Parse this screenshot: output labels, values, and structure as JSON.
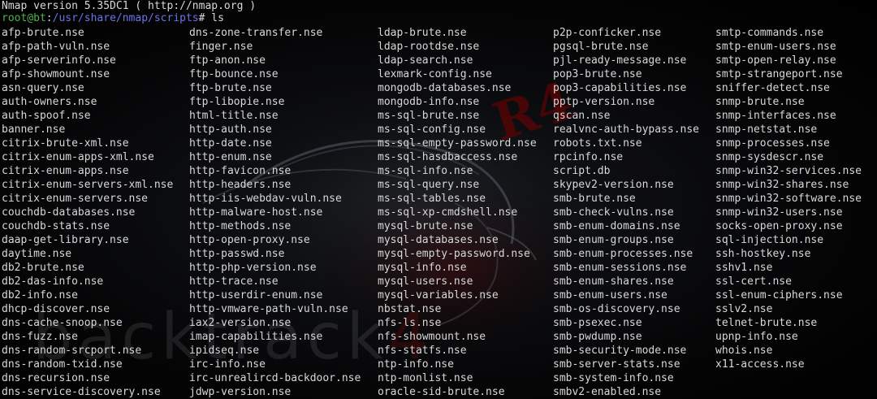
{
  "header": {
    "version_line": "Nmap version 5.35DC1 ( http://nmap.org )"
  },
  "prompt": {
    "user_host": "root@bt",
    "colon": ":",
    "path": "/usr/share/nmap/scripts",
    "symbol": "#",
    "command": " ls"
  },
  "wallpaper": {
    "watermark_left": "back",
    "watermark_mid": "track",
    "watermark_num": "4",
    "corner_mark": "R4",
    "accent_color": "#7a0000"
  },
  "colors": {
    "text": "#d8d8d8",
    "prompt_user": "#4fb34f",
    "prompt_path": "#6b74e8",
    "background": "#000000"
  },
  "listing": [
    [
      "afp-brute.nse",
      "afp-path-vuln.nse",
      "afp-serverinfo.nse",
      "afp-showmount.nse",
      "asn-query.nse",
      "auth-owners.nse",
      "auth-spoof.nse",
      "banner.nse",
      "citrix-brute-xml.nse",
      "citrix-enum-apps-xml.nse",
      "citrix-enum-apps.nse",
      "citrix-enum-servers-xml.nse",
      "citrix-enum-servers.nse",
      "couchdb-databases.nse",
      "couchdb-stats.nse",
      "daap-get-library.nse",
      "daytime.nse",
      "db2-brute.nse",
      "db2-das-info.nse",
      "db2-info.nse",
      "dhcp-discover.nse",
      "dns-cache-snoop.nse",
      "dns-fuzz.nse",
      "dns-random-srcport.nse",
      "dns-random-txid.nse",
      "dns-recursion.nse",
      "dns-service-discovery.nse"
    ],
    [
      "dns-zone-transfer.nse",
      "finger.nse",
      "ftp-anon.nse",
      "ftp-bounce.nse",
      "ftp-brute.nse",
      "ftp-libopie.nse",
      "html-title.nse",
      "http-auth.nse",
      "http-date.nse",
      "http-enum.nse",
      "http-favicon.nse",
      "http-headers.nse",
      "http-iis-webdav-vuln.nse",
      "http-malware-host.nse",
      "http-methods.nse",
      "http-open-proxy.nse",
      "http-passwd.nse",
      "http-php-version.nse",
      "http-trace.nse",
      "http-userdir-enum.nse",
      "http-vmware-path-vuln.nse",
      "iax2-version.nse",
      "imap-capabilities.nse",
      "ipidseq.nse",
      "irc-info.nse",
      "irc-unrealircd-backdoor.nse",
      "jdwp-version.nse"
    ],
    [
      "ldap-brute.nse",
      "ldap-rootdse.nse",
      "ldap-search.nse",
      "lexmark-config.nse",
      "mongodb-databases.nse",
      "mongodb-info.nse",
      "ms-sql-brute.nse",
      "ms-sql-config.nse",
      "ms-sql-empty-password.nse",
      "ms-sql-hasdbaccess.nse",
      "ms-sql-info.nse",
      "ms-sql-query.nse",
      "ms-sql-tables.nse",
      "ms-sql-xp-cmdshell.nse",
      "mysql-brute.nse",
      "mysql-databases.nse",
      "mysql-empty-password.nse",
      "mysql-info.nse",
      "mysql-users.nse",
      "mysql-variables.nse",
      "nbstat.nse",
      "nfs-ls.nse",
      "nfs-showmount.nse",
      "nfs-statfs.nse",
      "ntp-info.nse",
      "ntp-monlist.nse",
      "oracle-sid-brute.nse"
    ],
    [
      "p2p-conficker.nse",
      "pgsql-brute.nse",
      "pjl-ready-message.nse",
      "pop3-brute.nse",
      "pop3-capabilities.nse",
      "pptp-version.nse",
      "qscan.nse",
      "realvnc-auth-bypass.nse",
      "robots.txt.nse",
      "rpcinfo.nse",
      "script.db",
      "skypev2-version.nse",
      "smb-brute.nse",
      "smb-check-vulns.nse",
      "smb-enum-domains.nse",
      "smb-enum-groups.nse",
      "smb-enum-processes.nse",
      "smb-enum-sessions.nse",
      "smb-enum-shares.nse",
      "smb-enum-users.nse",
      "smb-os-discovery.nse",
      "smb-psexec.nse",
      "smb-pwdump.nse",
      "smb-security-mode.nse",
      "smb-server-stats.nse",
      "smb-system-info.nse",
      "smbv2-enabled.nse"
    ],
    [
      "smtp-commands.nse",
      "smtp-enum-users.nse",
      "smtp-open-relay.nse",
      "smtp-strangeport.nse",
      "sniffer-detect.nse",
      "snmp-brute.nse",
      "snmp-interfaces.nse",
      "snmp-netstat.nse",
      "snmp-processes.nse",
      "snmp-sysdescr.nse",
      "snmp-win32-services.nse",
      "snmp-win32-shares.nse",
      "snmp-win32-software.nse",
      "snmp-win32-users.nse",
      "socks-open-proxy.nse",
      "sql-injection.nse",
      "ssh-hostkey.nse",
      "sshv1.nse",
      "ssl-cert.nse",
      "ssl-enum-ciphers.nse",
      "sslv2.nse",
      "telnet-brute.nse",
      "upnp-info.nse",
      "whois.nse",
      "x11-access.nse"
    ]
  ]
}
